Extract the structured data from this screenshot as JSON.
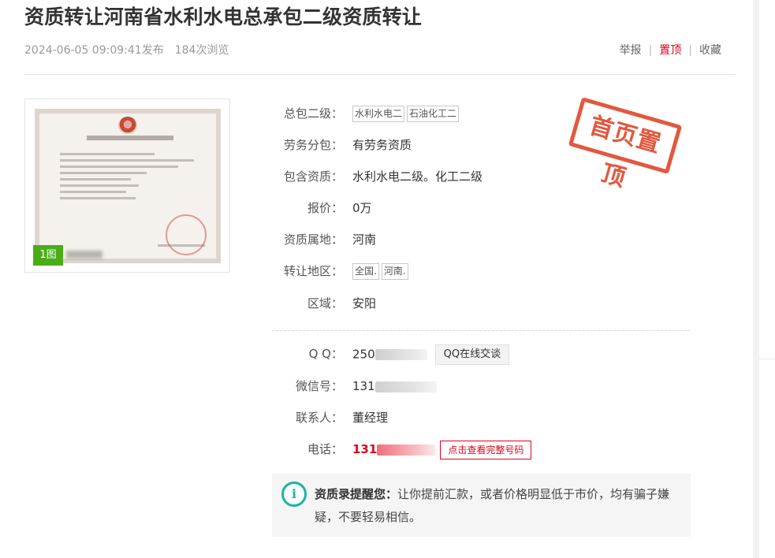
{
  "header": {
    "title": "资质转让河南省水利水电总承包二级资质转让",
    "date": "2024-06-05 09:09:41发布",
    "views": "184次浏览",
    "actions": {
      "report": "举报",
      "pin": "置顶",
      "favorite": "收藏"
    }
  },
  "gallery": {
    "count_badge": "1图"
  },
  "stamp": {
    "text": "首页置顶"
  },
  "details": [
    {
      "label": "总包二级：",
      "tags": [
        "水利水电二",
        "石油化工二"
      ]
    },
    {
      "label": "劳务分包：",
      "value": "有劳务资质"
    },
    {
      "label": "包含资质：",
      "value": "水利水电二级。化工二级"
    },
    {
      "label": "报价：",
      "value": "0万"
    },
    {
      "label": "资质属地：",
      "value": "河南"
    },
    {
      "label": "转让地区：",
      "tags": [
        "全国.",
        "河南."
      ]
    },
    {
      "label": "区域：",
      "value": "安阳"
    }
  ],
  "contact": {
    "qq_label": "Q Q：",
    "qq_value": "250",
    "qq_button": "QQ在线交谈",
    "wechat_label": "微信号：",
    "wechat_value": "131",
    "person_label": "联系人：",
    "person_value": "董经理",
    "phone_label": "电话：",
    "phone_value": "131",
    "phone_button": "点击查看完整号码"
  },
  "notice": {
    "icon": "info-icon",
    "title": "资质录提醒您：",
    "text": "让你提前汇款，或者价格明显低于市价，均有骗子嫌疑，不要轻易相信。"
  },
  "colors": {
    "accent_red": "#e3001b",
    "badge_green": "#4aad18",
    "info_teal": "#19b5a0",
    "stamp_red": "#e1462b"
  }
}
